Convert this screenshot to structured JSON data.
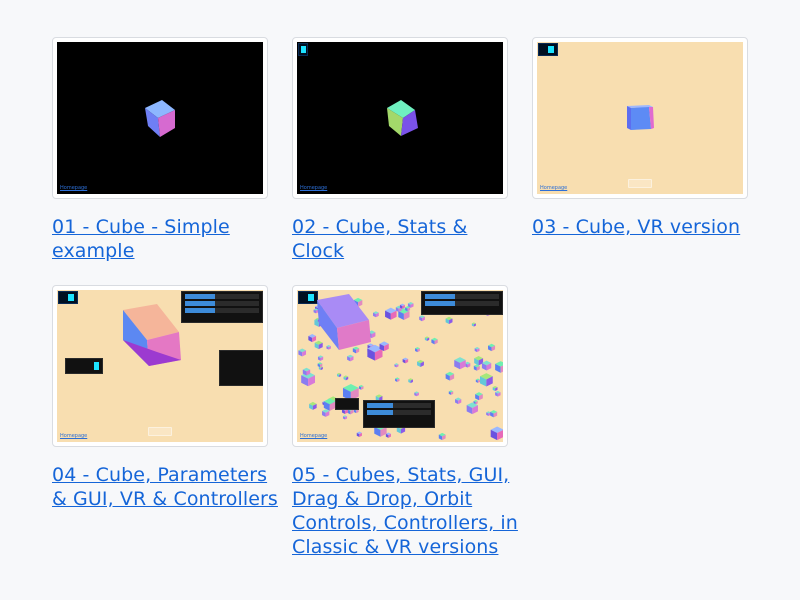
{
  "cards": [
    {
      "title": "01 - Cube - Simple example",
      "thumbnail": {
        "background": "black",
        "link_text": "Homepage"
      }
    },
    {
      "title": "02 - Cube, Stats & Clock",
      "thumbnail": {
        "background": "black",
        "link_text": "Homepage"
      }
    },
    {
      "title": "03 - Cube, VR version",
      "thumbnail": {
        "background": "tan",
        "link_text": "Homepage"
      }
    },
    {
      "title": "04 - Cube, Parameters & GUI, VR & Controllers",
      "thumbnail": {
        "background": "tan",
        "link_text": "Homepage"
      }
    },
    {
      "title": "05 - Cubes, Stats, GUI, Drag & Drop, Orbit Controls, Controllers, in Classic & VR versions",
      "thumbnail": {
        "background": "tan",
        "link_text": "Homepage"
      }
    }
  ],
  "colors": {
    "page_bg": "#f7f8fa",
    "link": "#1565d8",
    "scene_tan": "#f8deb0",
    "scene_black": "#000000"
  }
}
